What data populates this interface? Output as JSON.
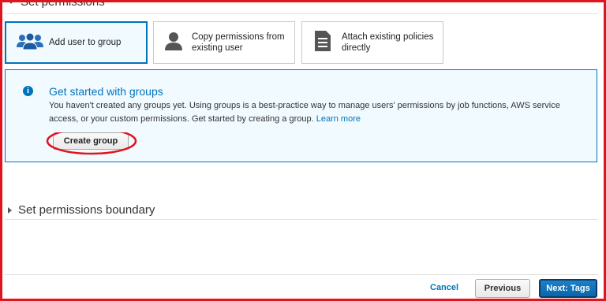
{
  "section": {
    "title": "Set permissions"
  },
  "options": [
    {
      "label": "Add user to group",
      "icon": "users-icon",
      "selected": true
    },
    {
      "label": "Copy permissions from existing user",
      "icon": "user-icon",
      "selected": false
    },
    {
      "label": "Attach existing policies directly",
      "icon": "document-icon",
      "selected": false
    }
  ],
  "info": {
    "title": "Get started with groups",
    "body": "You haven't created any groups yet. Using groups is a best-practice way to manage users' permissions by job functions, AWS service access, or your custom permissions. Get started by creating a group.",
    "link": "Learn more",
    "button": "Create group"
  },
  "boundary": {
    "title": "Set permissions boundary"
  },
  "footer": {
    "cancel": "Cancel",
    "previous": "Previous",
    "next": "Next: Tags"
  },
  "colors": {
    "accent": "#0073bb",
    "annotation": "#e0141e",
    "info_bg": "#f1faff"
  }
}
